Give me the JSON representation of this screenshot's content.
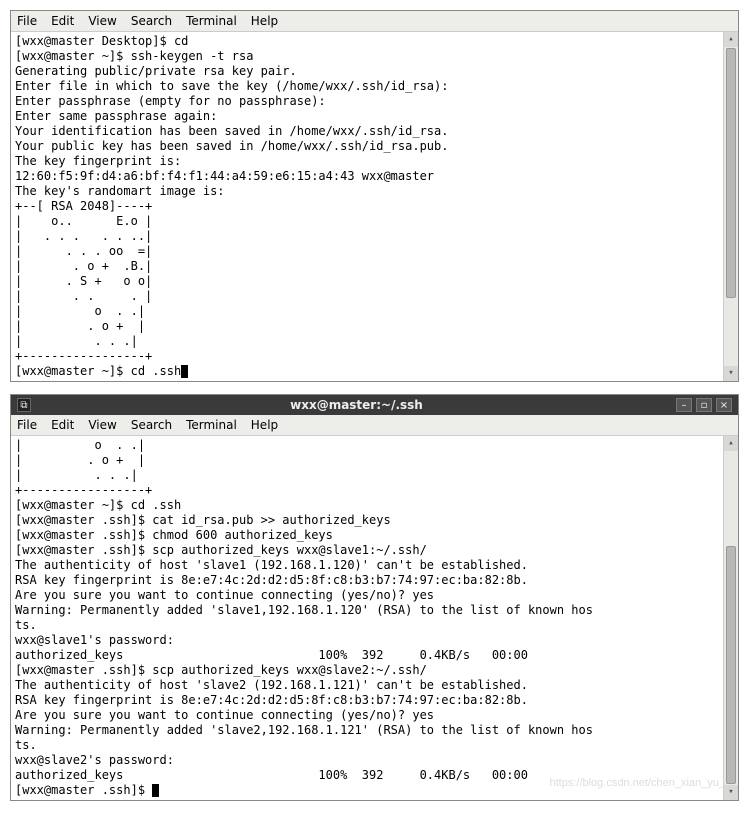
{
  "menu": {
    "file": "File",
    "edit": "Edit",
    "view": "View",
    "search": "Search",
    "terminal": "Terminal",
    "help": "Help"
  },
  "window2": {
    "title": "wxx@master:~/.ssh"
  },
  "term1": {
    "lines": [
      "[wxx@master Desktop]$ cd",
      "[wxx@master ~]$ ssh-keygen -t rsa",
      "Generating public/private rsa key pair.",
      "Enter file in which to save the key (/home/wxx/.ssh/id_rsa):",
      "Enter passphrase (empty for no passphrase):",
      "Enter same passphrase again:",
      "Your identification has been saved in /home/wxx/.ssh/id_rsa.",
      "Your public key has been saved in /home/wxx/.ssh/id_rsa.pub.",
      "The key fingerprint is:",
      "12:60:f5:9f:d4:a6:bf:f4:f1:44:a4:59:e6:15:a4:43 wxx@master",
      "The key's randomart image is:",
      "+--[ RSA 2048]----+",
      "|    o..      E.o |",
      "|   . . .   . . ..|",
      "|      . . . oo  =|",
      "|       . o +  .B.|",
      "|      . S +   o o|",
      "|       . .     . |",
      "|          o  . .|",
      "|         . o +  |",
      "|          . . .|",
      "+-----------------+",
      "[wxx@master ~]$ cd .ssh"
    ]
  },
  "term2": {
    "lines": [
      "|          o  . .|",
      "|         . o +  |",
      "|          . . .|",
      "+-----------------+",
      "[wxx@master ~]$ cd .ssh",
      "[wxx@master .ssh]$ cat id_rsa.pub >> authorized_keys",
      "[wxx@master .ssh]$ chmod 600 authorized_keys",
      "[wxx@master .ssh]$ scp authorized_keys wxx@slave1:~/.ssh/",
      "The authenticity of host 'slave1 (192.168.1.120)' can't be established.",
      "RSA key fingerprint is 8e:e7:4c:2d:d2:d5:8f:c8:b3:b7:74:97:ec:ba:82:8b.",
      "Are you sure you want to continue connecting (yes/no)? yes",
      "Warning: Permanently added 'slave1,192.168.1.120' (RSA) to the list of known hos",
      "ts.",
      "wxx@slave1's password:",
      "authorized_keys                           100%  392     0.4KB/s   00:00",
      "[wxx@master .ssh]$ scp authorized_keys wxx@slave2:~/.ssh/",
      "The authenticity of host 'slave2 (192.168.1.121)' can't be established.",
      "RSA key fingerprint is 8e:e7:4c:2d:d2:d5:8f:c8:b3:b7:74:97:ec:ba:82:8b.",
      "Are you sure you want to continue connecting (yes/no)? yes",
      "Warning: Permanently added 'slave2,192.168.1.121' (RSA) to the list of known hos",
      "ts.",
      "wxx@slave2's password:",
      "authorized_keys                           100%  392     0.4KB/s   00:00",
      "[wxx@master .ssh]$ "
    ]
  },
  "watermark": "https://blog.csdn.net/chen_xian_yu_"
}
